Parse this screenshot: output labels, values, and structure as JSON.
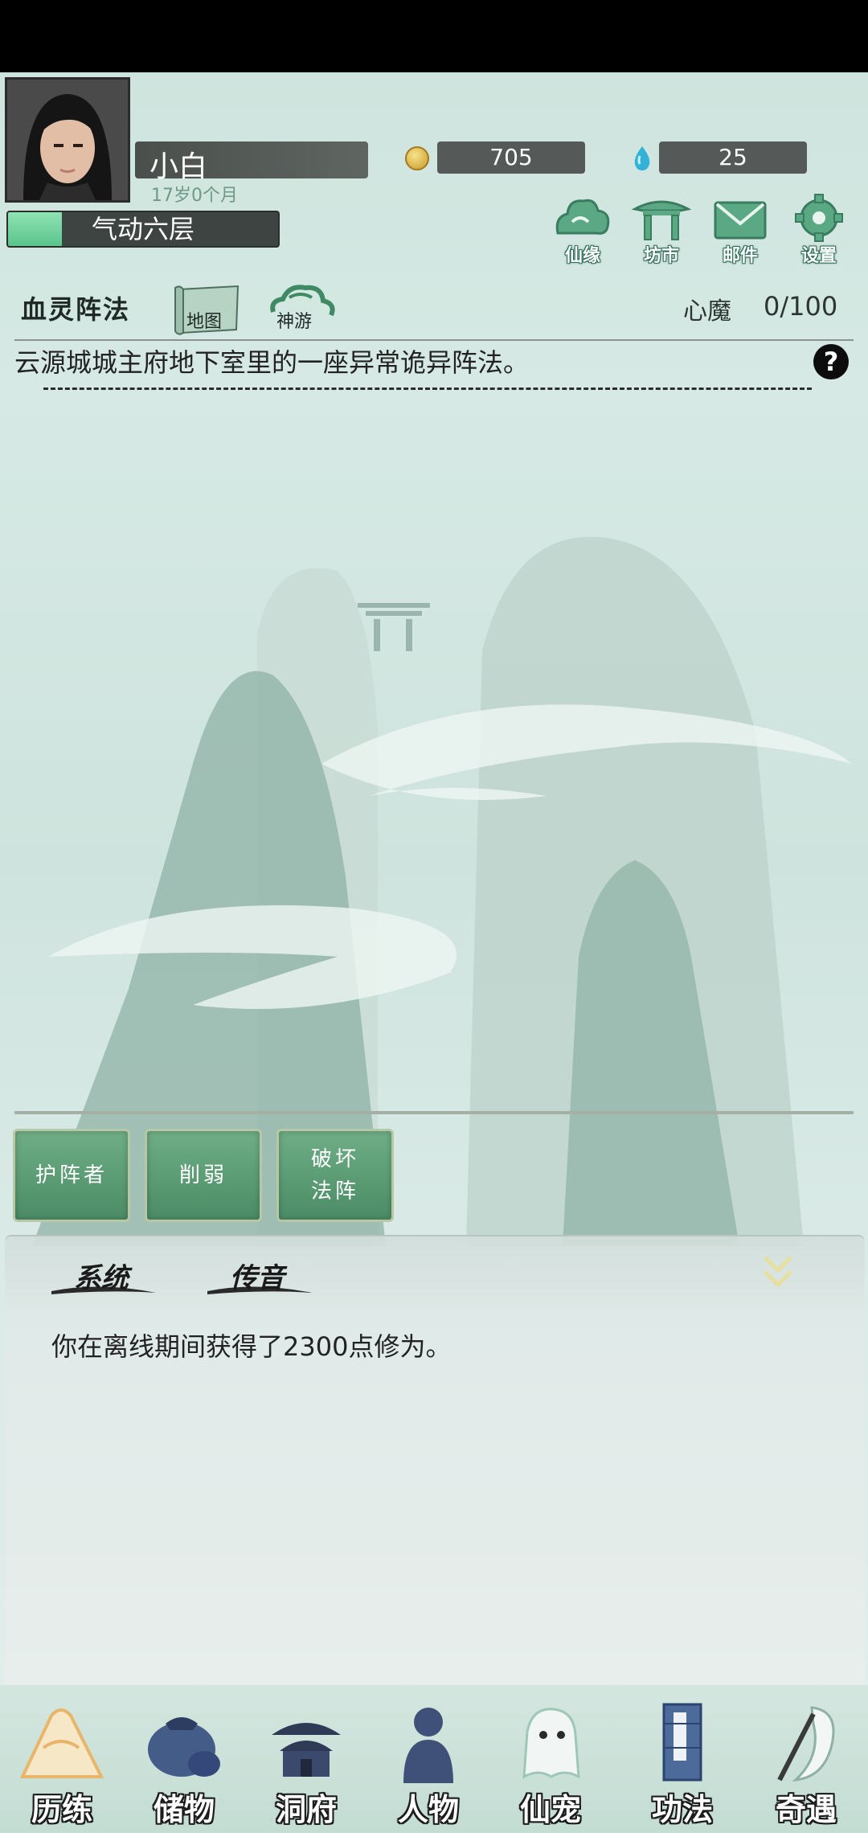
{
  "player": {
    "name": "小白",
    "age": "17岁0个月",
    "coins": "705",
    "gems": "25",
    "realm": "气动六层",
    "realm_progress": 0.2
  },
  "top_menu": [
    {
      "label": "仙缘",
      "icon": "cloud-icon"
    },
    {
      "label": "坊市",
      "icon": "pavilion-icon"
    },
    {
      "label": "邮件",
      "icon": "mail-icon"
    },
    {
      "label": "设置",
      "icon": "gear-icon"
    }
  ],
  "location": {
    "name": "血灵阵法",
    "map_label": "地图",
    "travel_label": "神游",
    "demon_label": "心魔",
    "demon_value": "0/100",
    "description": "云源城城主府地下室里的一座异常诡异阵法。",
    "help": "?"
  },
  "actions": [
    {
      "label": "护阵者"
    },
    {
      "label": "削弱"
    },
    {
      "label": "破坏\n法阵",
      "line1": "破坏",
      "line2": "法阵"
    }
  ],
  "log": {
    "tab_system": "系统",
    "tab_chat": "传音",
    "messages": [
      "你在离线期间获得了2300点修为。"
    ]
  },
  "nav": [
    {
      "label": "历练",
      "icon": "mountain-icon"
    },
    {
      "label": "储物",
      "icon": "pouch-icon"
    },
    {
      "label": "洞府",
      "icon": "palace-icon"
    },
    {
      "label": "人物",
      "icon": "person-icon"
    },
    {
      "label": "仙宠",
      "icon": "ghost-pet-icon"
    },
    {
      "label": "功法",
      "icon": "scroll-book-icon"
    },
    {
      "label": "奇遇",
      "icon": "crane-icon"
    }
  ],
  "colors": {
    "accent_green": "#4b8c66",
    "realm_fill": "#5ac48c",
    "background": "#d6e9e4"
  }
}
